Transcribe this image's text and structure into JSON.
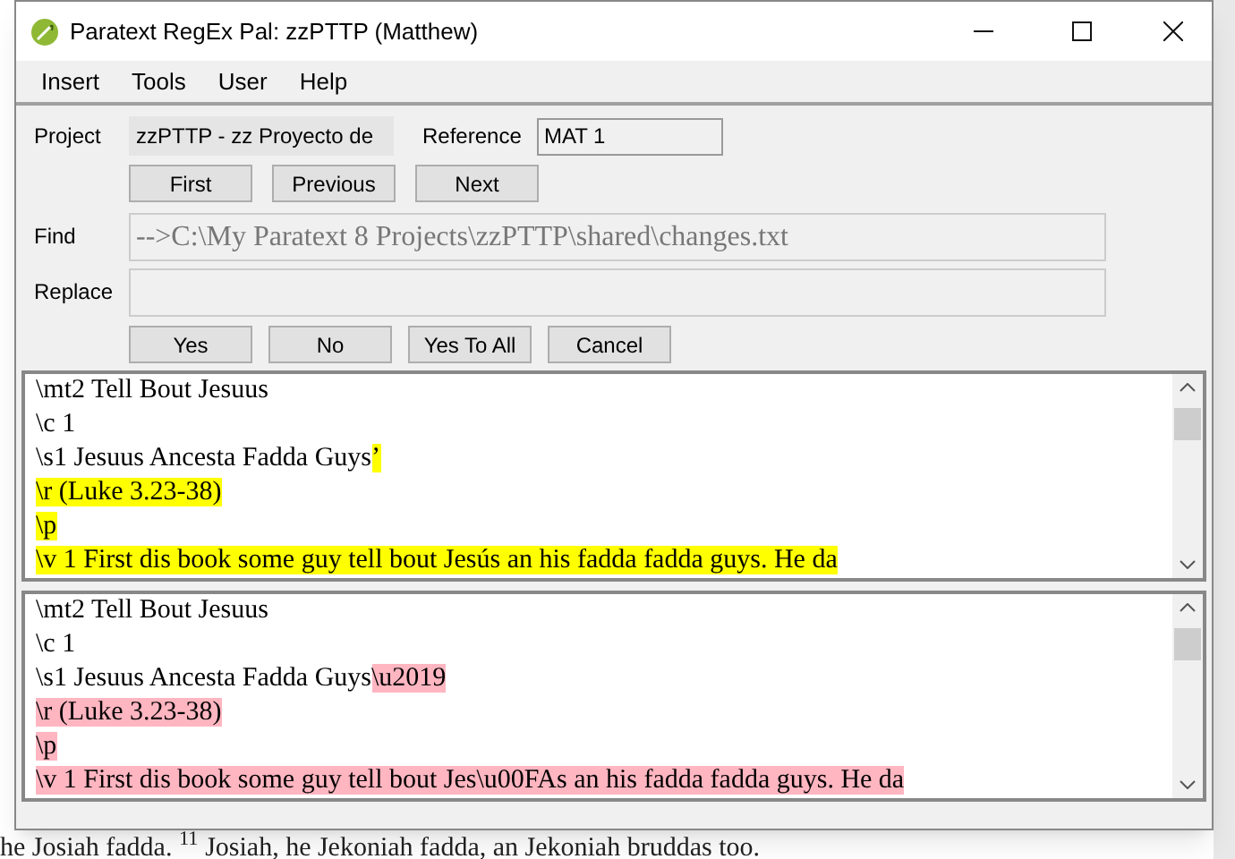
{
  "window": {
    "title": "Paratext RegEx Pal: zzPTTP (Matthew)"
  },
  "menu": [
    {
      "label": "Insert"
    },
    {
      "label": "Tools"
    },
    {
      "label": "User"
    },
    {
      "label": "Help"
    }
  ],
  "project": {
    "label": "Project",
    "value": "zzPTTP - zz Proyecto de"
  },
  "reference": {
    "label": "Reference",
    "value": "MAT 1"
  },
  "nav_buttons": [
    {
      "label": "First"
    },
    {
      "label": "Previous"
    },
    {
      "label": "Next"
    }
  ],
  "find": {
    "label": "Find",
    "value": "-->C:\\My Paratext 8 Projects\\zzPTTP\\shared\\changes.txt",
    "disabled": true
  },
  "replace": {
    "label": "Replace"
  },
  "action_buttons": [
    {
      "label": "Yes"
    },
    {
      "label": "No"
    },
    {
      "label": "Yes To All"
    },
    {
      "label": "Cancel"
    }
  ],
  "editors": [
    {
      "color": "#ffff00",
      "lines": [
        [
          {
            "text": "\\mt2 Tell Bout Jesuus",
            "highlight": false
          }
        ],
        [
          {
            "text": "\\c 1",
            "highlight": false
          }
        ],
        [
          {
            "text": "\\s1 Jesuus Ancesta Fadda Guys",
            "highlight": false
          },
          {
            "text": "’",
            "highlight": true
          }
        ],
        [
          {
            "text": "\\r (Luke 3.23-38)",
            "highlight": true
          }
        ],
        [
          {
            "text": "\\p",
            "highlight": true
          }
        ],
        [
          {
            "text": "\\v 1 First dis book some guy tell bout Jesús an his fadda fadda guys. He da",
            "highlight": true
          }
        ]
      ]
    },
    {
      "color": "#ffb6c1",
      "lines": [
        [
          {
            "text": "\\mt2 Tell Bout Jesuus",
            "highlight": false
          }
        ],
        [
          {
            "text": "\\c 1",
            "highlight": false
          }
        ],
        [
          {
            "text": "\\s1 Jesuus Ancesta Fadda Guys",
            "highlight": false
          },
          {
            "text": "\\u2019",
            "highlight": true
          }
        ],
        [
          {
            "text": "\\r (Luke 3.23-38)",
            "highlight": true
          }
        ],
        [
          {
            "text": "\\p",
            "highlight": true
          }
        ],
        [
          {
            "text": "\\v 1 First dis book some guy tell bout Jes\\u00FAs an his fadda fadda guys. He da",
            "highlight": true
          }
        ]
      ]
    }
  ],
  "background_text": "he Josiah fadda. $^{11}$ Josiah, he Jekoniah fadda, an Jekoniah bruddas too."
}
